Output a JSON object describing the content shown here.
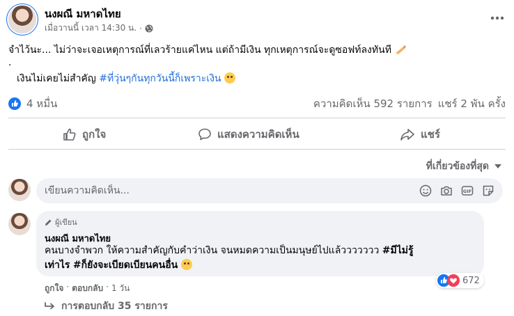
{
  "post": {
    "author": "นงผณี มหาดไทย",
    "timestamp": "เมื่อวานนี้ เวลา 14:30 น.",
    "privacy_icon": "globe-icon",
    "more_icon": "more-horizontal-icon",
    "line1": "จำไว้นะ... ไม่ว่าจะเจอเหตุการณ์ที่เลวร้ายแค่ไหน แต่ถ้ามีเงิน ทุกเหตุการณ์จะดูซอฟท์ลงทันที",
    "line2": ".",
    "line3_text": "เงินไม่เคยไม่สำคัญ",
    "line3_hashtag": "#ที่วุ่นๆกันทุกวันนี้ก็เพราะเงิน"
  },
  "stats": {
    "reactions": "4 หมื่น",
    "comments": "ความคิดเห็น 592 รายการ",
    "shares": "แชร์ 2 พัน ครั้ง"
  },
  "actions": {
    "like": "ถูกใจ",
    "comment": "แสดงความคิดเห็น",
    "share": "แชร์"
  },
  "sort": {
    "label": "ที่เกี่ยวข้องที่สุด"
  },
  "composer": {
    "placeholder": "เขียนความคิดเห็น..."
  },
  "comment": {
    "badge": "ผู้เขียน",
    "author": "นงผณี มหาดไทย",
    "text_line1": "คนบางจำพวก ให้ความสำคัญกับคำว่าเงิน จนหมดความเป็นมนุษย์ไปแล้ววววววว",
    "hashtag1_part1": "#มีไม่รู้",
    "hashtag1_part2": "เท่าไร",
    "hashtag2": "#ก็ยังจะเบียดเบียนคนอื่น",
    "like": "ถูกใจ",
    "reply": "ตอบกลับ",
    "time": "1 วัน",
    "reaction_count": "672",
    "replies_label": "การตอบกลับ 35 รายการ"
  },
  "colors": {
    "accent": "#1877f2",
    "hashtag": "#216fdb",
    "secondary_text": "#65676b"
  }
}
